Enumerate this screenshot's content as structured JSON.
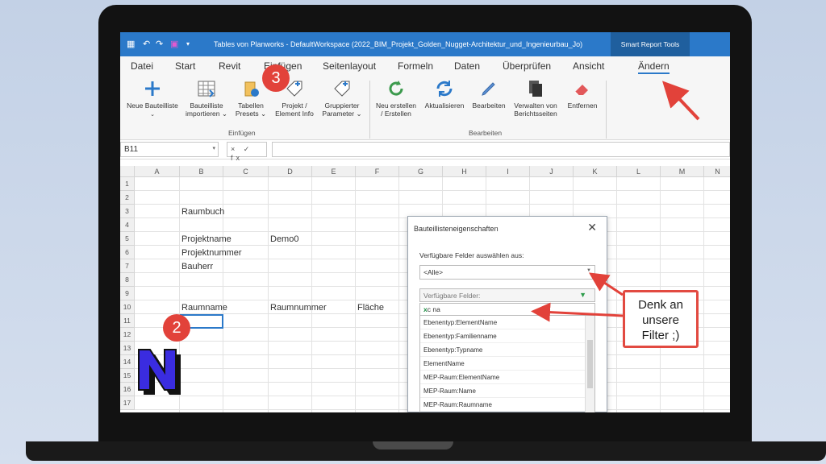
{
  "window": {
    "title": "Tables von Planworks - DefaultWorkspace  (2022_BIM_Projekt_Golden_Nugget-Architektur_und_Ingenieurbau_Jo)",
    "smart_tools": "Smart Report Tools"
  },
  "tabs": [
    "Datei",
    "Start",
    "Revit",
    "Einfügen",
    "Seitenlayout",
    "Formeln",
    "Daten",
    "Überprüfen",
    "Ansicht",
    "Ändern"
  ],
  "ribbon": {
    "neue_bauteilliste": "Neue Bauteilliste",
    "bauteilliste_importieren_1": "Bauteilliste",
    "bauteilliste_importieren_2": "importieren",
    "tabellen_presets_1": "Tabellen",
    "tabellen_presets_2": "Presets",
    "projekt_info_1": "Projekt /",
    "projekt_info_2": "Element Info",
    "gruppierter_parameter_1": "Gruppierter",
    "gruppierter_parameter_2": "Parameter",
    "group_einfuegen": "Einfügen",
    "neu_erstellen_1": "Neu erstellen",
    "neu_erstellen_2": "/ Erstellen",
    "aktualisieren": "Aktualisieren",
    "bearbeiten": "Bearbeiten",
    "verwalten_1": "Verwalten von",
    "verwalten_2": "Berichtsseiten",
    "entfernen": "Entfernen",
    "group_bearbeiten": "Bearbeiten"
  },
  "formula_bar": {
    "cell_ref": "B11",
    "fx_icons": "× ✓ fx",
    "value": ""
  },
  "grid": {
    "columns": [
      "A",
      "B",
      "C",
      "D",
      "E",
      "F",
      "G",
      "H",
      "I",
      "J",
      "K",
      "L",
      "M",
      "N"
    ],
    "rows": [
      "1",
      "2",
      "3",
      "4",
      "5",
      "6",
      "7",
      "8",
      "9",
      "10",
      "11",
      "12",
      "13",
      "14",
      "15",
      "16",
      "17"
    ],
    "cells": {
      "b3": "Raumbuch",
      "b5": "Projektname",
      "d5": "Demo0",
      "b6": "Projektnummer",
      "b7": "Bauherr",
      "b10": "Raumname",
      "d10": "Raumnummer",
      "f10": "Fläche"
    }
  },
  "dialog": {
    "title": "Bauteillisteneigenschaften",
    "close": "✕",
    "label": "Verfügbare Felder auswählen aus:",
    "select_value": "<Alle>",
    "list_header": "Verfügbare Felder:",
    "search_value": "na",
    "items": [
      "Ebenentyp:ElementName",
      "Ebenentyp:Familienname",
      "Ebenentyp:Typname",
      "ElementName",
      "MEP-Raum:ElementName",
      "MEP-Raum:Name",
      "MEP-Raum:Raumname"
    ]
  },
  "annotations": {
    "callout_1": "Denk an",
    "callout_2": "unsere",
    "callout_3": "Filter ;)",
    "badge_3": "3",
    "badge_2": "2",
    "accent": "#e2423a"
  }
}
